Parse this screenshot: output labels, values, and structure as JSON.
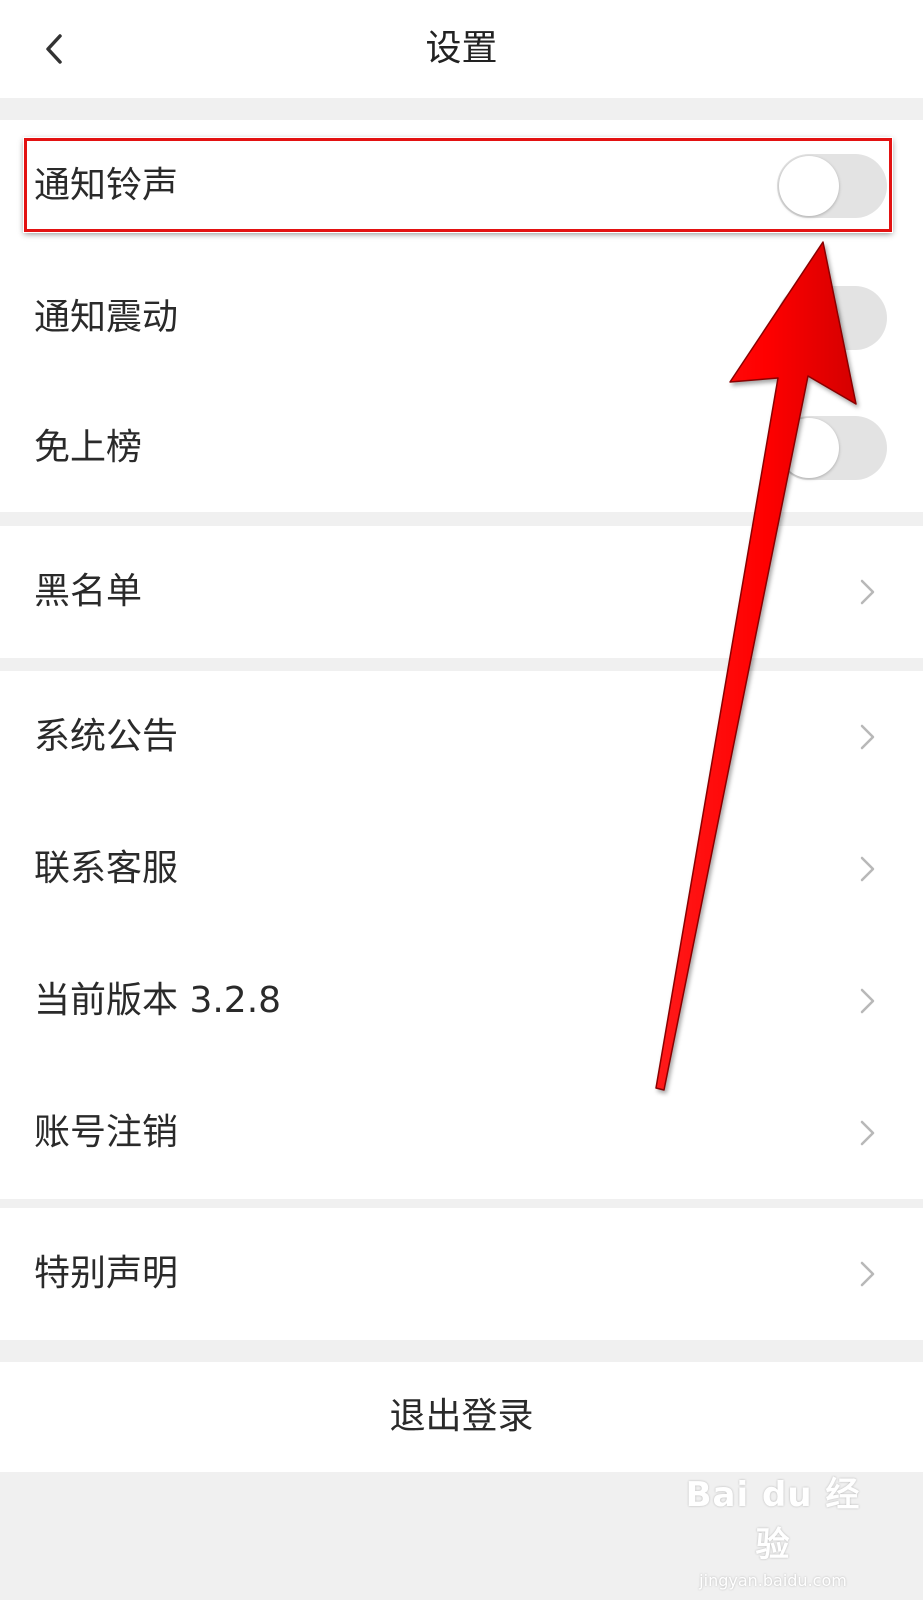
{
  "header": {
    "title": "设置"
  },
  "groups": [
    {
      "rows": [
        {
          "label": "通知铃声",
          "control": "toggle",
          "on": false
        },
        {
          "label": "通知震动",
          "control": "toggle",
          "on": false
        },
        {
          "label": "免上榜",
          "control": "toggle",
          "on": false
        }
      ]
    },
    {
      "rows": [
        {
          "label": "黑名单",
          "control": "chevron"
        }
      ]
    },
    {
      "rows": [
        {
          "label": "系统公告",
          "control": "chevron"
        },
        {
          "label": "联系客服",
          "control": "chevron"
        },
        {
          "label": "当前版本 3.2.8",
          "control": "chevron"
        },
        {
          "label": "账号注销",
          "control": "chevron"
        }
      ]
    },
    {
      "rows": [
        {
          "label": "特别声明",
          "control": "chevron"
        }
      ]
    }
  ],
  "logout": {
    "label": "退出登录"
  },
  "watermark": {
    "logo": "Bai du 经验",
    "url": "jingyan.baidu.com"
  },
  "colors": {
    "annotation_red": "#e31212",
    "background": "#f0f0f0",
    "toggle_off": "#e3e3e3"
  }
}
